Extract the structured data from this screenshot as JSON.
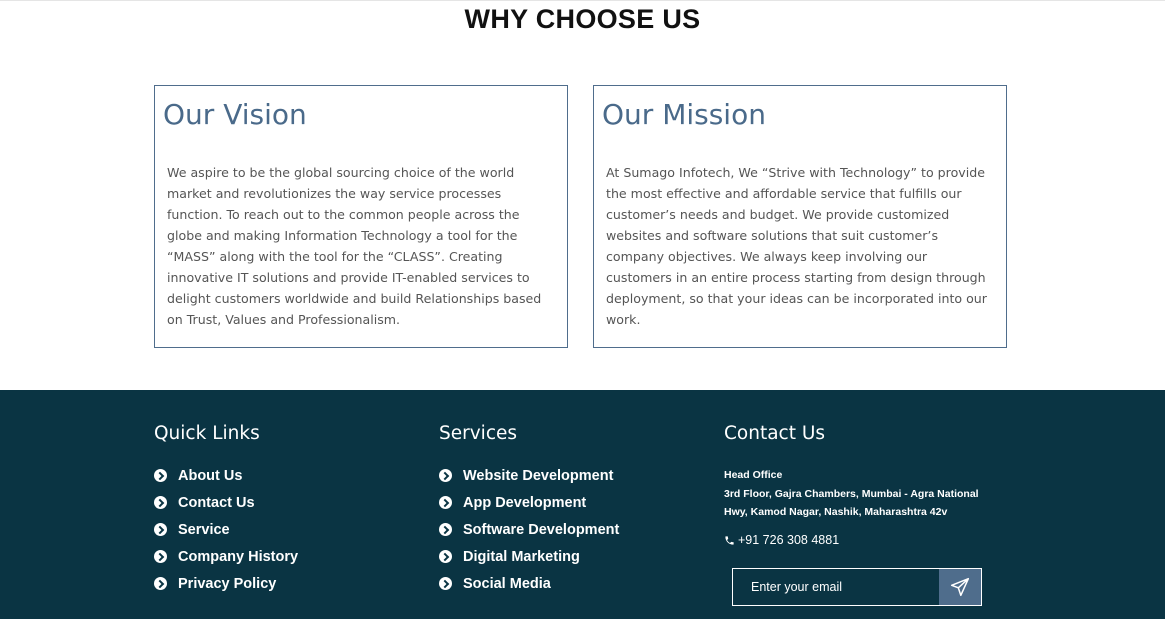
{
  "section": {
    "heading": "WHY CHOOSE US"
  },
  "vision": {
    "title": "Our Vision",
    "text": "We aspire to be the global sourcing choice of the world market and revolutionizes the way service processes function. To reach out to the common people across the globe and making Information Technology a tool for the “MASS” along with the tool for the “CLASS”. Creating innovative IT solutions and provide IT-enabled services to delight customers worldwide and build Relationships based on Trust, Values and Professionalism."
  },
  "mission": {
    "title": "Our Mission",
    "text": "At Sumago Infotech, We “Strive with Technology” to provide the most effective and affordable service that fulfills our customer’s needs and budget. We provide customized websites and software solutions that suit customer’s company objectives. We always keep involving our customers in an entire process starting from design through deployment, so that your ideas can be incorporated into our work."
  },
  "footer": {
    "quick_links": {
      "title": "Quick Links",
      "items": [
        "About Us",
        "Contact Us",
        "Service",
        "Company History",
        "Privacy Policy"
      ]
    },
    "services": {
      "title": "Services",
      "items": [
        "Website Development",
        "App Development",
        "Software Development",
        "Digital Marketing",
        "Social Media"
      ]
    },
    "contact": {
      "title": "Contact Us",
      "office_label": "Head Office",
      "address": "3rd Floor, Gajra Chambers, Mumbai - Agra National Hwy, Kamod Nagar, Nashik, Maharashtra 42v",
      "phone": "+91 726 308 4881",
      "email_placeholder": "Enter your email",
      "send_icon": "paper-plane-icon",
      "phone_icon": "phone-icon"
    },
    "colors": {
      "background": "#0a3443",
      "accent": "#4f6d8c"
    }
  }
}
